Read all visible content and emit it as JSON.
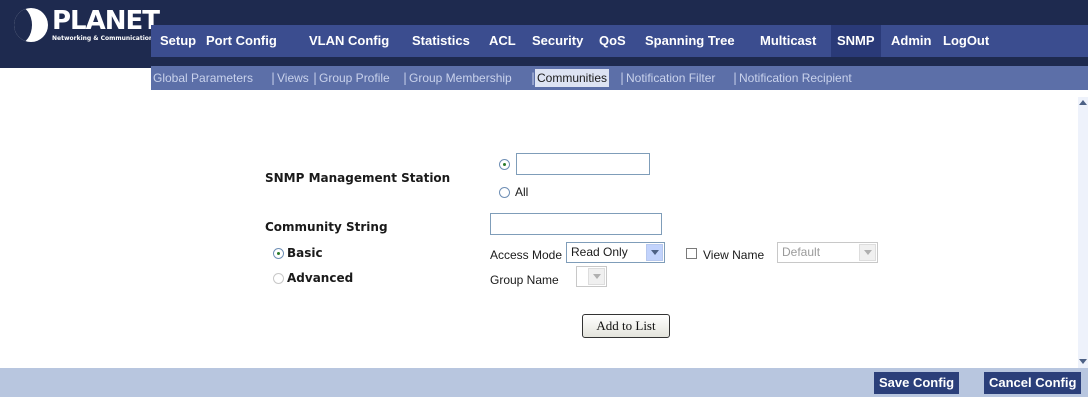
{
  "brand": {
    "name": "PLANET",
    "tagline": "Networking & Communication"
  },
  "main_nav": [
    "Setup",
    "Port Config",
    "VLAN Config",
    "Statistics",
    "ACL",
    "Security",
    "QoS",
    "Spanning Tree",
    "Multicast",
    "SNMP",
    "Admin",
    "LogOut"
  ],
  "active_main": "SNMP",
  "sub_nav": [
    "Global Parameters",
    "Views",
    "Group Profile",
    "Group Membership",
    "Communities",
    "Notification Filter",
    "Notification Recipient"
  ],
  "active_sub": "Communities",
  "form": {
    "snmp_station_label": "SNMP Management Station",
    "station_option_all": "All",
    "station_value": "",
    "community_label": "Community String",
    "community_value": "",
    "basic_label": "Basic",
    "advanced_label": "Advanced",
    "access_mode_label": "Access Mode",
    "access_mode_value": "Read Only",
    "view_name_label": "View Name",
    "view_name_value": "Default",
    "group_name_label": "Group Name",
    "group_name_value": "",
    "add_button": "Add to List"
  },
  "footer": {
    "save": "Save Config",
    "cancel": "Cancel Config"
  }
}
